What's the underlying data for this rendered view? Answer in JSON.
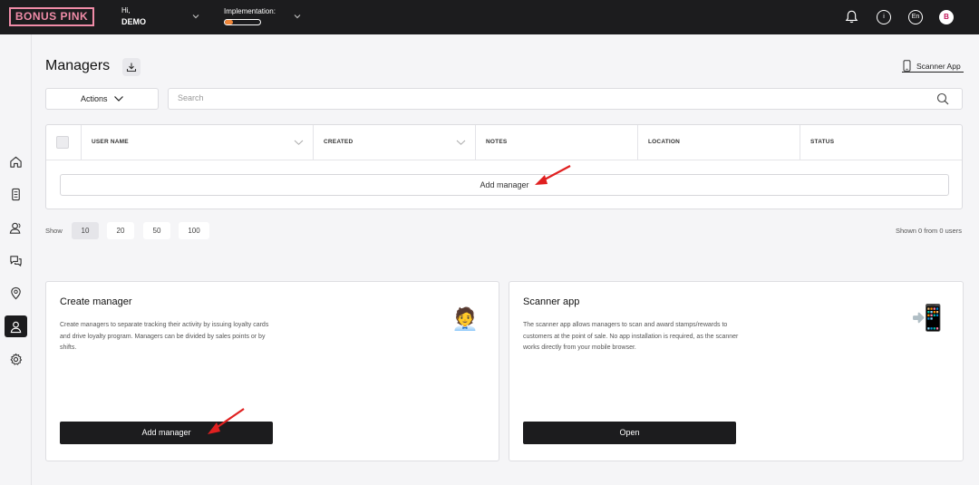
{
  "brand": {
    "logo": "BONUS PINK",
    "logo_color": "#f08ca8"
  },
  "header": {
    "greeting": "Hi,",
    "user_name": "DEMO",
    "implementation_label": "Implementation:",
    "implementation_progress": 0.22,
    "progress_color": "#f0873a",
    "info_icon": "i",
    "language": "En",
    "avatar_letter": "B"
  },
  "page": {
    "title": "Managers",
    "scanner_app_link": "Scanner App",
    "actions_label": "Actions",
    "search_placeholder": "Search"
  },
  "table": {
    "columns": [
      "USER NAME",
      "CREATED",
      "NOTES",
      "LOCATION",
      "STATUS"
    ],
    "add_button": "Add manager"
  },
  "pagination": {
    "show_label": "Show",
    "options": [
      "10",
      "20",
      "50",
      "100"
    ],
    "selected": "10",
    "summary": "Shown 0 from 0 users"
  },
  "cards": [
    {
      "title": "Create manager",
      "text": "Create managers to separate tracking their activity by issuing loyalty cards and drive loyalty program. Managers can be divided by sales points or by shifts.",
      "emoji": "🧑‍💼",
      "button": "Add manager"
    },
    {
      "title": "Scanner app",
      "text": "The scanner app allows managers to scan and award stamps/rewards to customers at the point of sale. No app installation is required, as the scanner works directly from your mobile browser.",
      "emoji": "📲",
      "button": "Open"
    }
  ],
  "annotation_color": "#e02020"
}
